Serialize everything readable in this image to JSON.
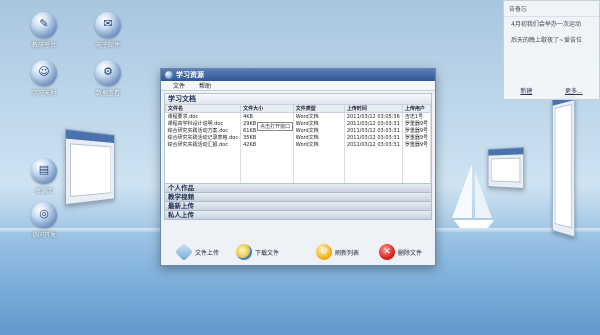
{
  "desktop": {
    "icons": [
      {
        "label": "教研平台",
        "glyph": "✎"
      },
      {
        "label": "电子邮件",
        "glyph": "✉"
      },
      {
        "label": "学习天地",
        "glyph": "☺"
      },
      {
        "label": "数据查看",
        "glyph": "⚙"
      },
      {
        "label": "资源库",
        "glyph": "▤"
      },
      {
        "label": "协同开发",
        "glyph": "◎"
      }
    ]
  },
  "note": {
    "title": "告备忘",
    "line1": "4月初我们会举办一次运动",
    "line2": "后天的晚上歇夜了~爱告位",
    "link_left": "新建",
    "link_right": "更多..."
  },
  "window": {
    "title": "学习资源",
    "menu": [
      "文件",
      "帮助"
    ],
    "section_title": "学习文档",
    "columns": [
      "文件名",
      "文件大小",
      "文件类型",
      "上传时间",
      "上传用户"
    ],
    "rows": [
      [
        "课程要求.doc",
        "4KB",
        "Word文档",
        "2011/03/12 03:05:36",
        "吉忠1号"
      ],
      [
        "课程高学科设计说明.doc",
        "29KB",
        "Word文档",
        "2011/03/12 03:03:31",
        "罗重器9号"
      ],
      [
        "综合研究实践活动方案.doc",
        "61KB",
        "Word文档",
        "2011/03/12 03:03:31",
        "罗重器9号"
      ],
      [
        "综合研究实践活动记录表格.doc",
        "35KB",
        "Word文档",
        "2011/03/12 03:03:31",
        "罗重器9号"
      ],
      [
        "综合研究实践活动汇报.doc",
        "42KB",
        "Word文档",
        "2011/03/12 03:03:31",
        "罗重器9号"
      ]
    ],
    "tooltip": "点击打开窗口",
    "collapsed_sections": [
      "个人作品",
      "教学视频",
      "最新上传",
      "私人上传"
    ],
    "actions": {
      "upload": "文件上传",
      "download": "下载文件",
      "refresh": "刷新列表",
      "delete": "删除文件"
    }
  }
}
